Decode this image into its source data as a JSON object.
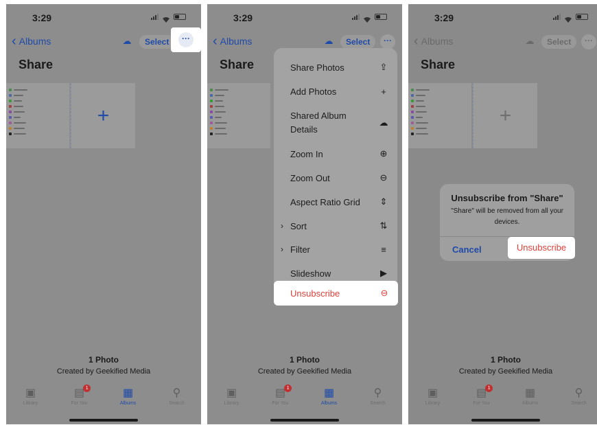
{
  "colors": {
    "accent": "#1e4aa8",
    "destructive": "#e0403a",
    "dim_overlay": "#8d8d8d",
    "highlight": "#ffffff"
  },
  "status": {
    "time": "3:29"
  },
  "nav": {
    "back_label": "Albums",
    "select_label": "Select",
    "more_label": "···"
  },
  "album": {
    "title": "Share",
    "photo_count": "1 Photo",
    "created_by": "Created by Geekified Media"
  },
  "tabs": [
    {
      "label": "Library",
      "icon": "photo-library-icon"
    },
    {
      "label": "For You",
      "icon": "for-you-icon",
      "badge": "1"
    },
    {
      "label": "Albums",
      "icon": "albums-icon"
    },
    {
      "label": "Search",
      "icon": "search-icon"
    }
  ],
  "menu": {
    "items": [
      {
        "label": "Share Photos",
        "icon": "share-icon"
      },
      {
        "label": "Add Photos",
        "icon": "plus-icon"
      },
      {
        "label": "Shared Album Details",
        "icon": "shared-album-icon"
      },
      {
        "label": "Zoom In",
        "icon": "zoom-in-icon"
      },
      {
        "label": "Zoom Out",
        "icon": "zoom-out-icon"
      },
      {
        "label": "Aspect Ratio Grid",
        "icon": "aspect-ratio-icon"
      },
      {
        "label": "Sort",
        "icon": "sort-icon"
      },
      {
        "label": "Filter",
        "icon": "filter-icon"
      },
      {
        "label": "Slideshow",
        "icon": "slideshow-icon"
      },
      {
        "label": "Unsubscribe",
        "icon": "minus-circle-icon"
      }
    ]
  },
  "alert": {
    "title": "Unsubscribe from \"Share\"",
    "message": "\"Share\" will be removed from all your devices.",
    "cancel_label": "Cancel",
    "confirm_label": "Unsubscribe"
  }
}
